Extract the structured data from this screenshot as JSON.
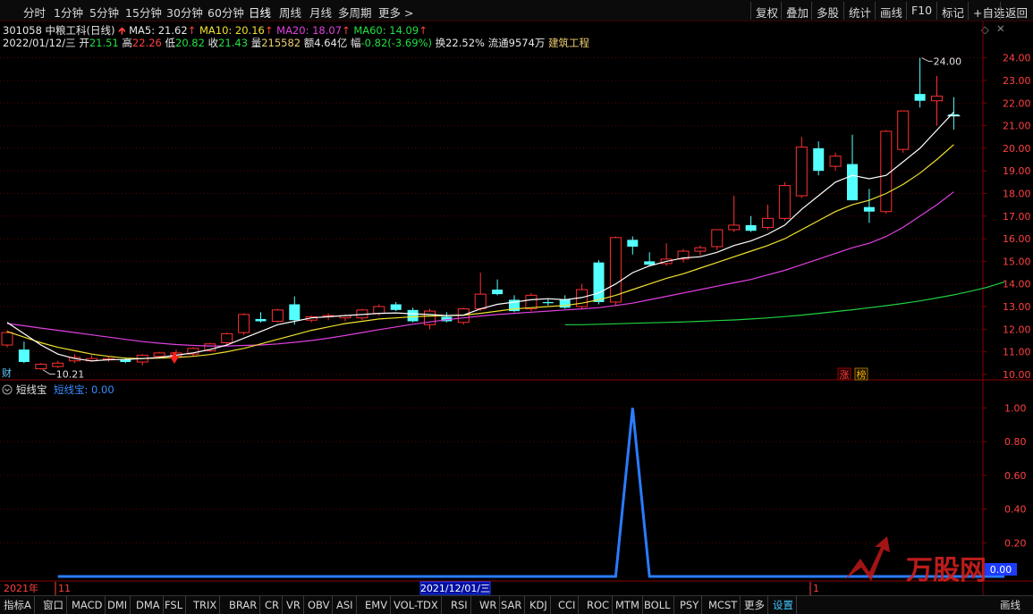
{
  "toolbar": {
    "left": [
      "分时",
      "1分钟",
      "5分钟",
      "15分钟",
      "30分钟",
      "60分钟",
      "日线",
      "周线",
      "月线",
      "多周期",
      "更多 >"
    ],
    "active": "日线",
    "right": [
      "复权",
      "叠加",
      "多股",
      "统计",
      "画线",
      "F10",
      "标记",
      "+自选",
      "返回"
    ]
  },
  "stock": {
    "code_name": "301058 中粮工科(日线)",
    "ma5": "MA5: 21.62",
    "ma10": "MA10: 20.16",
    "ma20": "MA20: 18.07",
    "ma60": "MA60: 14.09",
    "date": "2022/01/12/三",
    "open_lbl": "开",
    "open": "21.51",
    "high_lbl": "高",
    "high": "22.26",
    "low_lbl": "低",
    "low": "20.82",
    "close_lbl": "收",
    "close": "21.43",
    "vol_lbl": "量",
    "vol": "215582",
    "amount_lbl": "额",
    "amount": "4.64亿",
    "chg_lbl": "幅",
    "chg": "-0.82(-3.69%)",
    "turnover": "换22.52%",
    "float": "流通9574万",
    "industry": "建筑工程"
  },
  "chart_data": [
    {
      "type": "candlestick",
      "yticks": [
        "24.00",
        "23.00",
        "22.00",
        "21.00",
        "20.00",
        "19.00",
        "18.00",
        "17.00",
        "16.00",
        "15.00",
        "14.00",
        "13.00",
        "12.00",
        "11.00",
        "10.00"
      ],
      "ylim": [
        9.8,
        24.5
      ],
      "candles": [
        {
          "o": 11.3,
          "h": 11.95,
          "l": 11.2,
          "c": 11.85
        },
        {
          "o": 11.1,
          "h": 11.45,
          "l": 10.5,
          "c": 10.55
        },
        {
          "o": 10.25,
          "h": 10.5,
          "l": 10.21,
          "c": 10.45
        },
        {
          "o": 10.35,
          "h": 10.6,
          "l": 10.28,
          "c": 10.5
        },
        {
          "o": 10.6,
          "h": 10.9,
          "l": 10.5,
          "c": 10.75
        },
        {
          "o": 10.6,
          "h": 10.85,
          "l": 10.55,
          "c": 10.7
        },
        {
          "o": 10.65,
          "h": 10.8,
          "l": 10.55,
          "c": 10.7
        },
        {
          "o": 10.65,
          "h": 10.75,
          "l": 10.5,
          "c": 10.55
        },
        {
          "o": 10.55,
          "h": 10.9,
          "l": 10.4,
          "c": 10.85
        },
        {
          "o": 10.8,
          "h": 11.0,
          "l": 10.7,
          "c": 10.95
        },
        {
          "o": 10.8,
          "h": 11.1,
          "l": 10.7,
          "c": 10.95
        },
        {
          "o": 10.9,
          "h": 11.2,
          "l": 10.8,
          "c": 11.15
        },
        {
          "o": 11.05,
          "h": 11.4,
          "l": 11.0,
          "c": 11.35
        },
        {
          "o": 11.4,
          "h": 11.85,
          "l": 11.3,
          "c": 11.8
        },
        {
          "o": 11.85,
          "h": 12.7,
          "l": 11.75,
          "c": 12.65
        },
        {
          "o": 12.45,
          "h": 12.75,
          "l": 12.3,
          "c": 12.35
        },
        {
          "o": 12.35,
          "h": 12.9,
          "l": 12.3,
          "c": 12.85
        },
        {
          "o": 13.1,
          "h": 13.45,
          "l": 12.2,
          "c": 12.4
        },
        {
          "o": 12.4,
          "h": 12.6,
          "l": 12.3,
          "c": 12.55
        },
        {
          "o": 12.55,
          "h": 12.7,
          "l": 12.4,
          "c": 12.6
        },
        {
          "o": 12.5,
          "h": 12.65,
          "l": 12.35,
          "c": 12.6
        },
        {
          "o": 12.5,
          "h": 12.9,
          "l": 12.4,
          "c": 12.85
        },
        {
          "o": 12.7,
          "h": 13.1,
          "l": 12.6,
          "c": 13.0
        },
        {
          "o": 13.1,
          "h": 13.2,
          "l": 12.8,
          "c": 12.85
        },
        {
          "o": 12.85,
          "h": 12.95,
          "l": 12.3,
          "c": 12.35
        },
        {
          "o": 12.2,
          "h": 12.9,
          "l": 12.0,
          "c": 12.8
        },
        {
          "o": 12.55,
          "h": 12.75,
          "l": 12.3,
          "c": 12.35
        },
        {
          "o": 12.3,
          "h": 12.95,
          "l": 12.2,
          "c": 12.9
        },
        {
          "o": 12.9,
          "h": 14.5,
          "l": 12.8,
          "c": 13.55
        },
        {
          "o": 13.75,
          "h": 14.2,
          "l": 13.5,
          "c": 13.55
        },
        {
          "o": 13.3,
          "h": 13.5,
          "l": 12.75,
          "c": 12.8
        },
        {
          "o": 12.9,
          "h": 13.6,
          "l": 12.8,
          "c": 13.5
        },
        {
          "o": 13.2,
          "h": 13.35,
          "l": 13.05,
          "c": 13.15
        },
        {
          "o": 13.3,
          "h": 13.5,
          "l": 12.9,
          "c": 12.95
        },
        {
          "o": 13.0,
          "h": 14.0,
          "l": 12.9,
          "c": 13.75
        },
        {
          "o": 14.95,
          "h": 15.05,
          "l": 13.1,
          "c": 13.2
        },
        {
          "o": 13.2,
          "h": 16.1,
          "l": 13.05,
          "c": 16.05
        },
        {
          "o": 15.95,
          "h": 16.1,
          "l": 15.3,
          "c": 15.65
        },
        {
          "o": 15.0,
          "h": 15.4,
          "l": 14.8,
          "c": 14.85
        },
        {
          "o": 14.9,
          "h": 15.8,
          "l": 14.8,
          "c": 15.1
        },
        {
          "o": 15.1,
          "h": 15.55,
          "l": 14.95,
          "c": 15.45
        },
        {
          "o": 15.45,
          "h": 15.7,
          "l": 15.25,
          "c": 15.6
        },
        {
          "o": 15.65,
          "h": 16.4,
          "l": 15.5,
          "c": 16.4
        },
        {
          "o": 16.4,
          "h": 17.9,
          "l": 16.3,
          "c": 16.6
        },
        {
          "o": 16.6,
          "h": 17.0,
          "l": 16.3,
          "c": 16.35
        },
        {
          "o": 16.5,
          "h": 17.5,
          "l": 16.4,
          "c": 16.9
        },
        {
          "o": 16.9,
          "h": 18.5,
          "l": 16.8,
          "c": 18.35
        },
        {
          "o": 17.9,
          "h": 20.5,
          "l": 17.8,
          "c": 20.05
        },
        {
          "o": 20.0,
          "h": 20.3,
          "l": 18.8,
          "c": 19.0
        },
        {
          "o": 19.2,
          "h": 19.8,
          "l": 19.0,
          "c": 19.65
        },
        {
          "o": 19.3,
          "h": 20.6,
          "l": 17.7,
          "c": 17.7
        },
        {
          "o": 17.4,
          "h": 18.2,
          "l": 16.7,
          "c": 17.2
        },
        {
          "o": 17.2,
          "h": 20.8,
          "l": 17.1,
          "c": 20.75
        },
        {
          "o": 19.95,
          "h": 21.5,
          "l": 19.8,
          "c": 21.65
        },
        {
          "o": 22.4,
          "h": 24.0,
          "l": 21.8,
          "c": 22.1
        },
        {
          "o": 22.1,
          "h": 23.2,
          "l": 21.0,
          "c": 22.3
        },
        {
          "o": 21.5,
          "h": 22.26,
          "l": 20.82,
          "c": 21.43
        }
      ],
      "ma5": [
        12.3,
        11.8,
        11.3,
        10.9,
        10.7,
        10.6,
        10.65,
        10.66,
        10.7,
        10.75,
        10.85,
        10.95,
        11.1,
        11.3,
        11.6,
        11.9,
        12.2,
        12.35,
        12.5,
        12.55,
        12.6,
        12.65,
        12.7,
        12.72,
        12.68,
        12.65,
        12.6,
        12.62,
        12.9,
        13.1,
        13.2,
        13.3,
        13.35,
        13.3,
        13.4,
        13.6,
        14.0,
        14.5,
        14.8,
        15.0,
        15.15,
        15.2,
        15.4,
        15.7,
        15.9,
        16.2,
        16.6,
        17.3,
        17.9,
        18.5,
        18.8,
        18.65,
        18.8,
        19.4,
        20.0,
        20.8,
        21.6
      ],
      "ma10": [
        11.9,
        11.65,
        11.4,
        11.2,
        11.05,
        10.9,
        10.8,
        10.72,
        10.7,
        10.72,
        10.75,
        10.8,
        10.88,
        11.0,
        11.15,
        11.35,
        11.55,
        11.75,
        11.95,
        12.1,
        12.25,
        12.35,
        12.45,
        12.5,
        12.55,
        12.58,
        12.6,
        12.62,
        12.7,
        12.8,
        12.9,
        12.95,
        13.0,
        13.05,
        13.15,
        13.3,
        13.5,
        13.75,
        14.0,
        14.25,
        14.45,
        14.7,
        14.95,
        15.2,
        15.45,
        15.7,
        16.0,
        16.4,
        16.8,
        17.2,
        17.5,
        17.7,
        18.0,
        18.4,
        18.9,
        19.5,
        20.16
      ],
      "ma20": [
        12.25,
        12.15,
        12.05,
        11.95,
        11.85,
        11.75,
        11.65,
        11.55,
        11.45,
        11.38,
        11.32,
        11.28,
        11.26,
        11.26,
        11.28,
        11.3,
        11.35,
        11.42,
        11.5,
        11.6,
        11.72,
        11.85,
        11.98,
        12.1,
        12.22,
        12.32,
        12.42,
        12.5,
        12.58,
        12.65,
        12.7,
        12.75,
        12.8,
        12.85,
        12.9,
        12.95,
        13.05,
        13.15,
        13.3,
        13.45,
        13.6,
        13.75,
        13.9,
        14.05,
        14.2,
        14.4,
        14.6,
        14.85,
        15.1,
        15.35,
        15.6,
        15.8,
        16.1,
        16.5,
        17.0,
        17.5,
        18.07
      ],
      "ma60_start": 33,
      "ma60": [
        12.2,
        12.2,
        12.22,
        12.24,
        12.26,
        12.28,
        12.3,
        12.32,
        12.35,
        12.38,
        12.41,
        12.45,
        12.5,
        12.56,
        12.62,
        12.7,
        12.78,
        12.86,
        12.95,
        13.04,
        13.14,
        13.25,
        13.38,
        13.52,
        13.68,
        13.86,
        14.09
      ],
      "low_label": "10.21",
      "high_label": "24.00",
      "zt_label": "涨",
      "bang_label": "榜",
      "cai_label": "财"
    },
    {
      "type": "line",
      "name": "短线宝",
      "indicator_title": "短线宝",
      "indicator_value": "短线宝: 0.00",
      "yticks": [
        "1.00",
        "0.80",
        "0.60",
        "0.40",
        "0.20"
      ],
      "last_value_label": "0.00",
      "ylim": [
        0,
        1.05
      ],
      "values": [
        0,
        0,
        0,
        0,
        0,
        0,
        0,
        0,
        0,
        0,
        0,
        0,
        0,
        0,
        0,
        0,
        0,
        0,
        0,
        0,
        0,
        0,
        0,
        0,
        0,
        0,
        0,
        0,
        0,
        0,
        0,
        0,
        0,
        0,
        1,
        0,
        0,
        0,
        0,
        0,
        0,
        0,
        0,
        0,
        0,
        0,
        0,
        0,
        0,
        0,
        0,
        0,
        0,
        0,
        0,
        0,
        0
      ],
      "start_index": 3
    }
  ],
  "xaxis": {
    "year": "2021年",
    "m1": "11",
    "cursor_date": "2021/12/01/三",
    "m2": "1"
  },
  "bottom_tabs": [
    "指标A",
    "窗口",
    "MACD",
    "DMI",
    "DMA",
    "FSL",
    "TRIX",
    "BRAR",
    "CR",
    "VR",
    "OBV",
    "ASI",
    "EMV",
    "VOL-TDX",
    "RSI",
    "WR",
    "SAR",
    "KDJ",
    "CCI",
    "ROC",
    "MTM",
    "BOLL",
    "PSY",
    "MCST",
    "更多",
    "设置"
  ],
  "bottom_right": "画线",
  "watermark": "万股网",
  "colors": {
    "up": "#ff3030",
    "down": "#54ffff",
    "ma5": "#ffffff",
    "ma10": "#f0e030",
    "ma20": "#e040e0",
    "ma60": "#20d040",
    "indicator": "#2a7cff",
    "frame": "#8a0000"
  }
}
